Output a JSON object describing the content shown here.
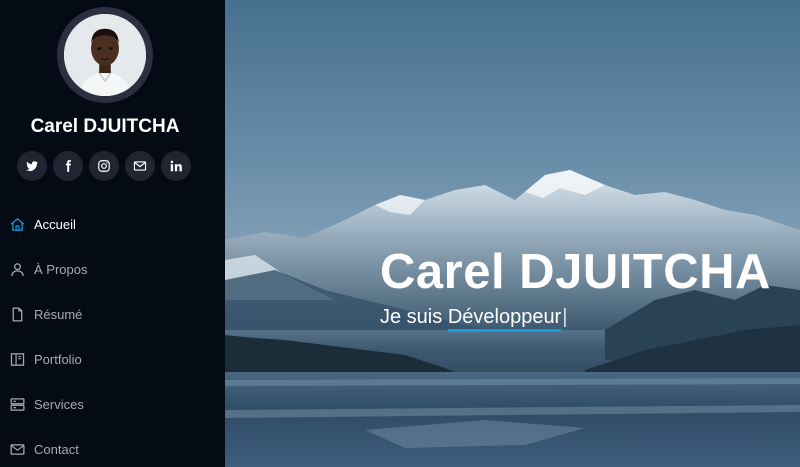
{
  "profile": {
    "name": "Carel DJUITCHA"
  },
  "social": [
    {
      "name": "twitter-icon"
    },
    {
      "name": "facebook-icon"
    },
    {
      "name": "instagram-icon"
    },
    {
      "name": "email-icon"
    },
    {
      "name": "linkedin-icon"
    }
  ],
  "nav": {
    "items": [
      {
        "label": "Accueil",
        "icon": "home-icon",
        "active": true
      },
      {
        "label": "À Propos",
        "icon": "user-icon"
      },
      {
        "label": "Résumé",
        "icon": "file-icon"
      },
      {
        "label": "Portfolio",
        "icon": "book-icon"
      },
      {
        "label": "Services",
        "icon": "server-icon"
      },
      {
        "label": "Contact",
        "icon": "envelope-icon"
      }
    ]
  },
  "hero": {
    "title": "Carel DJUITCHA",
    "prefix": "Je suis ",
    "typed": "Développeur",
    "cursor": "|"
  },
  "colors": {
    "accent": "#149ddd",
    "sidebar_bg": "#040b14",
    "social_bg": "#212431",
    "nav_text": "#a8a9b4"
  }
}
